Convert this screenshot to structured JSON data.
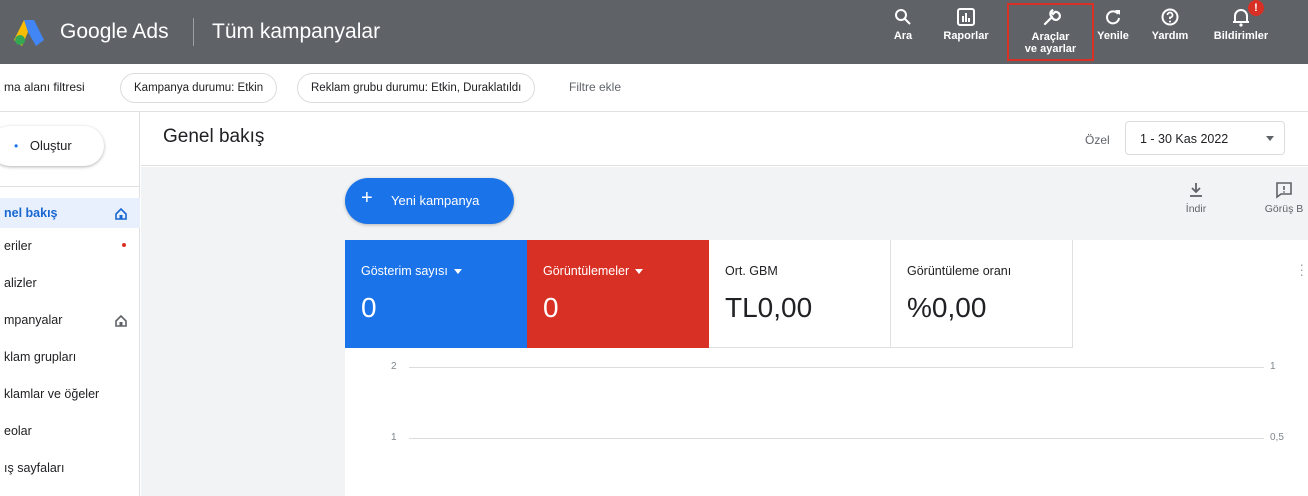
{
  "header": {
    "brand": "Google Ads",
    "title": "Tüm kampanyalar",
    "tools": {
      "search": "Ara",
      "reports": "Raporlar",
      "tools_line1": "Araçlar",
      "tools_line2": "ve ayarlar",
      "refresh": "Yenile",
      "help": "Yardım",
      "notifications": "Bildirimler"
    },
    "notification_badge": "!"
  },
  "filters": {
    "label": "ma alanı filtresi",
    "chips": [
      "Kampanya durumu: Etkin",
      "Reklam grubu durumu: Etkin, Duraklatıldı"
    ],
    "add": "Filtre ekle"
  },
  "sidebar": {
    "create_label": "Oluştur",
    "items": [
      {
        "label": "nel bakış"
      },
      {
        "label": "eriler"
      },
      {
        "label": "alizler"
      },
      {
        "label": "mpanyalar"
      },
      {
        "label": "klam grupları"
      },
      {
        "label": "klamlar ve öğeler"
      },
      {
        "label": "eolar"
      },
      {
        "label": "ış sayfaları"
      }
    ]
  },
  "overview": {
    "title": "Genel bakış",
    "date_label": "Özel",
    "date_range": "1 - 30 Kas 2022"
  },
  "actions": {
    "new_campaign": "Yeni kampanya",
    "download": "İndir",
    "feedback": "Görüş B"
  },
  "metrics": [
    {
      "label": "Gösterim sayısı",
      "value": "0"
    },
    {
      "label": "Görüntülemeler",
      "value": "0"
    },
    {
      "label": "Ort. GBM",
      "value": "TL0,00"
    },
    {
      "label": "Görüntüleme oranı",
      "value": "%0,00"
    }
  ],
  "chart": {
    "left_ticks": [
      "2",
      "1"
    ],
    "right_ticks": [
      "1",
      "0,5"
    ]
  },
  "colors": {
    "header_bg": "#5f6368",
    "accent_blue": "#1a73e8",
    "accent_red": "#d93025",
    "highlight_box": "#d93025"
  }
}
